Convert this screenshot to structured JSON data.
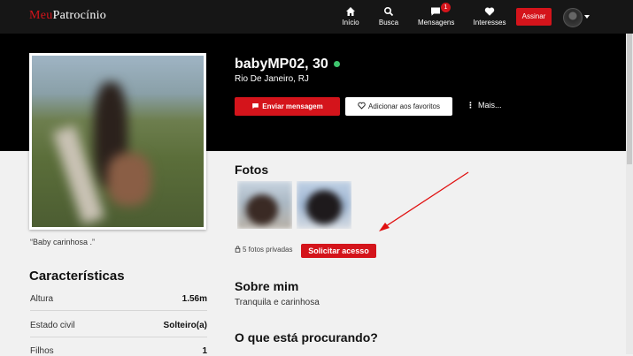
{
  "brand": {
    "logo_part1": "Meu",
    "logo_part2": "Patrocínio",
    "accent": "#d4141b"
  },
  "nav": {
    "items": [
      {
        "label": "Início",
        "icon": "home-icon"
      },
      {
        "label": "Busca",
        "icon": "search-icon"
      },
      {
        "label": "Mensagens",
        "icon": "chat-icon",
        "badge": "1"
      },
      {
        "label": "Interesses",
        "icon": "heart-icon"
      }
    ],
    "subscribe_label": "Assinar"
  },
  "profile": {
    "name_age": "babyMP02, 30",
    "online_color": "#3ec46d",
    "location": "Rio De Janeiro, RJ",
    "send_message_label": "Enviar mensagem",
    "add_favorite_label": "Adicionar aos favoritos",
    "more_label": "Mais...",
    "caption": "“Baby carinhosa .”"
  },
  "characteristics": {
    "title": "Características",
    "rows": [
      {
        "label": "Altura",
        "value": "1.56m"
      },
      {
        "label": "Estado civil",
        "value": "Solteiro(a)"
      },
      {
        "label": "Filhos",
        "value": "1"
      }
    ]
  },
  "photos": {
    "title": "Fotos",
    "private_count": "5 fotos privadas",
    "request_access_label": "Solicitar acesso"
  },
  "about": {
    "title": "Sobre mim",
    "text": "Tranquila e carinhosa"
  },
  "looking_for": {
    "title": "O que está procurando?"
  }
}
